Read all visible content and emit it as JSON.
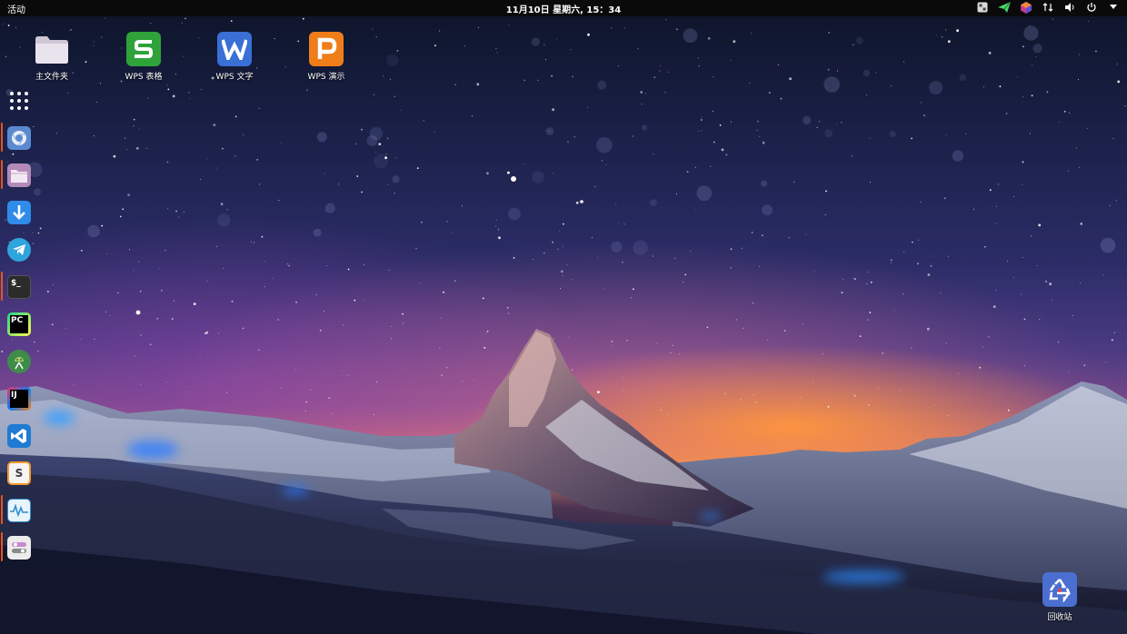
{
  "topbar": {
    "activities": "活动",
    "clock": "11月10日 星期六, 15：34",
    "tray_icons": [
      "panel-app-icon",
      "send-icon",
      "color-picker-icon",
      "network-icon",
      "volume-icon",
      "power-icon",
      "menu-arrow-icon"
    ]
  },
  "desktop": {
    "icons": [
      {
        "label": "主文件夹",
        "icon": "folder-icon"
      },
      {
        "label": "WPS 表格",
        "icon": "wps-spreadsheet-icon"
      },
      {
        "label": "WPS 文字",
        "icon": "wps-writer-icon"
      },
      {
        "label": "WPS 演示",
        "icon": "wps-presentation-icon"
      }
    ],
    "trash": {
      "label": "回收站",
      "icon": "recycle-bin-icon"
    }
  },
  "dock": {
    "items": [
      {
        "name": "show-applications",
        "icon": "app-grid-icon",
        "running": false
      },
      {
        "name": "chromium",
        "icon": "chromium-icon",
        "running": true
      },
      {
        "name": "files",
        "icon": "files-icon",
        "running": true
      },
      {
        "name": "downloader",
        "icon": "download-icon",
        "running": false
      },
      {
        "name": "telegram",
        "icon": "telegram-icon",
        "running": false
      },
      {
        "name": "terminal",
        "icon": "terminal-icon",
        "running": true,
        "text": "$_"
      },
      {
        "name": "pycharm",
        "icon": "pycharm-icon",
        "running": false,
        "text": "PC"
      },
      {
        "name": "android-studio",
        "icon": "android-studio-icon",
        "running": false
      },
      {
        "name": "intellij-idea",
        "icon": "intellij-icon",
        "running": false,
        "text": "IJ"
      },
      {
        "name": "vscode",
        "icon": "vscode-icon",
        "running": false
      },
      {
        "name": "sublime-text",
        "icon": "sublime-icon",
        "running": false,
        "text": "S"
      },
      {
        "name": "system-monitor",
        "icon": "system-monitor-icon",
        "running": true
      },
      {
        "name": "tweaks",
        "icon": "tweaks-icon",
        "running": true
      }
    ]
  },
  "colors": {
    "topbar_bg": "#0a0a0a",
    "running_indicator": "#e8551f",
    "wps_spreadsheet": "#2fa33a",
    "wps_writer": "#3a6fd6",
    "wps_presentation": "#ef7d1a"
  }
}
